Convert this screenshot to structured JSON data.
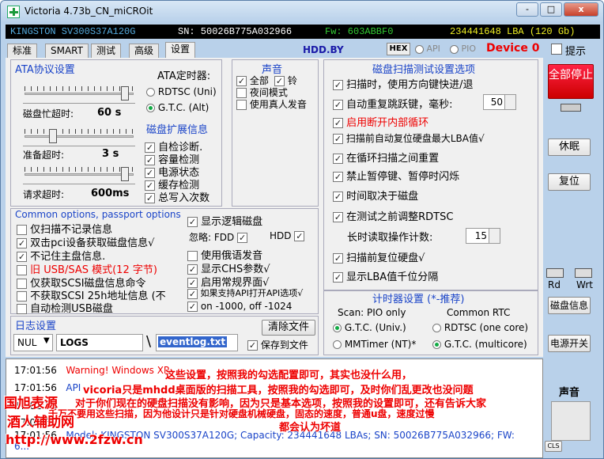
{
  "window": {
    "title": "Victoria 4.73b_CN_miCROit",
    "btn_min": "-",
    "btn_max": "□",
    "btn_close": "x"
  },
  "info": {
    "drive": "KINGSTON SV300S37A120G",
    "sn": "SN: 50026B775A032966",
    "fw": "Fw: 603ABBF0",
    "lba": "234441648 LBA (120 Gb)"
  },
  "tabs": [
    "标准",
    "SMART",
    "测试",
    "高级",
    "设置"
  ],
  "hdd_by": "HDD.BY",
  "hex": "HEX",
  "api_label": "API",
  "pio_label": "PIO",
  "device": "Device 0",
  "hint": "提示",
  "ata": {
    "title": "ATA协议设置",
    "timer_title": "ATA定时器:",
    "rdtsc": "RDTSC (Uni)",
    "gtc": "G.T.C. (Alt)",
    "busy": "磁盘忙超时:",
    "busy_val": "60 s",
    "busy_pos": 0.95,
    "ready": "准备超时:",
    "ready_val": "3 s",
    "ready_pos": 0.25,
    "req": "请求超时:",
    "req_val": "600ms",
    "req_pos": 0.95
  },
  "ext": {
    "title": "磁盘扩展信息",
    "items": [
      "自检诊断.",
      "容量检测",
      "电源状态",
      "缓存检测",
      "总写入次数"
    ]
  },
  "sound": {
    "title": "声音",
    "all": "全部",
    "bell": "铃",
    "night": "夜间模式",
    "human": "使用真人发音"
  },
  "scan": {
    "title": "磁盘扫描测试设置选项",
    "items": [
      "扫描时，使用方向键快进/退",
      "自动重复跳跃键，毫秒:",
      "启用断开内部循环",
      "扫描前自动复位硬盘最大LBA值√",
      "在循环扫描之间重置",
      "禁止暂停键、暂停时闪烁",
      "时间取决于磁盘",
      "在测试之前调整RDTSC"
    ],
    "ms_val": "50",
    "read_count": "长时读取操作计数:",
    "read_val": "15",
    "reset": "扫描前复位硬盘√",
    "lba_thousand": "显示LBA值千位分隔"
  },
  "timer": {
    "title": "计时器设置 (*-推荐)",
    "scan": "Scan: PIO only",
    "common": "Common RTC",
    "gtc_univ": "G.T.C. (Univ.)",
    "rdtsc_core": "RDTSC (one core)",
    "mmtimer": "MMTimer (NT)*",
    "gtc_multi": "G.T.C. (multicore)"
  },
  "common": {
    "title": "Common options, passport options",
    "left": [
      "仅扫描不记录信息",
      "双击pci设备获取磁盘信息√",
      "不记住主盘信息.",
      "旧 USB/SAS 模式(12 字节)",
      "仅获取SCSI磁盘信息命令",
      "不获取SCSI 25h地址信息 (不",
      "自动检测USB磁盘"
    ],
    "right": [
      "显示逻辑磁盘",
      "忽略: FDD",
      "HDD",
      "使用俄语发音",
      "显示CHS参数√",
      "启用常规界面√",
      "如果支持API打开API选项√",
      "on -1000, off -1024"
    ]
  },
  "logset": {
    "title": "日志设置",
    "nul": "NUL",
    "logs": "LOGS",
    "sep": "\\",
    "file": "eventlog.txt",
    "clear": "清除文件",
    "save": "保存到文件"
  },
  "log": [
    {
      "time": "17:01:56",
      "msg": "Warning! Windows XP"
    },
    {
      "time": "17:01:56",
      "msg": "API"
    },
    {
      "time": "17:01:56",
      "msg": ""
    },
    {
      "time": "17:01:56",
      "msg": ""
    },
    {
      "time": "17:01:56",
      "msg": "Model: KINGSTON SV300S37A120G; Capacity: 234441648 LBAs; SN: 50026B775A032966; FW: 6..."
    }
  ],
  "right": {
    "stop": "全部停止",
    "sleep": "休眠",
    "reset": "复位",
    "rd": "Rd",
    "wrt": "Wrt",
    "diskinfo": "磁盘信息",
    "power": "电源开关",
    "sound": "声音",
    "cls": "CLS"
  },
  "overlay": {
    "l1": "这些设置，按照我的勾选配置即可，其实也没什么用，",
    "l2": "vicoria只是mhdd桌面版的扫描工具，按照我的勾选即可，及时你们乱更改也没问题",
    "l3": "对于你们现在的硬盘扫描没有影响，因为只是基本选项，按照我的设置即可，还有告诉大家",
    "l4": "千万不要用这些扫描，因为他设计只是针对硬盘机械硬盘，固态的速度，普通u盘，速度过慢",
    "l5": "都会认为坏道"
  },
  "watermark": {
    "l1": "国旭表源",
    "l2": "酒人辅助网",
    "l3": "http://www.2fzw.cn"
  }
}
